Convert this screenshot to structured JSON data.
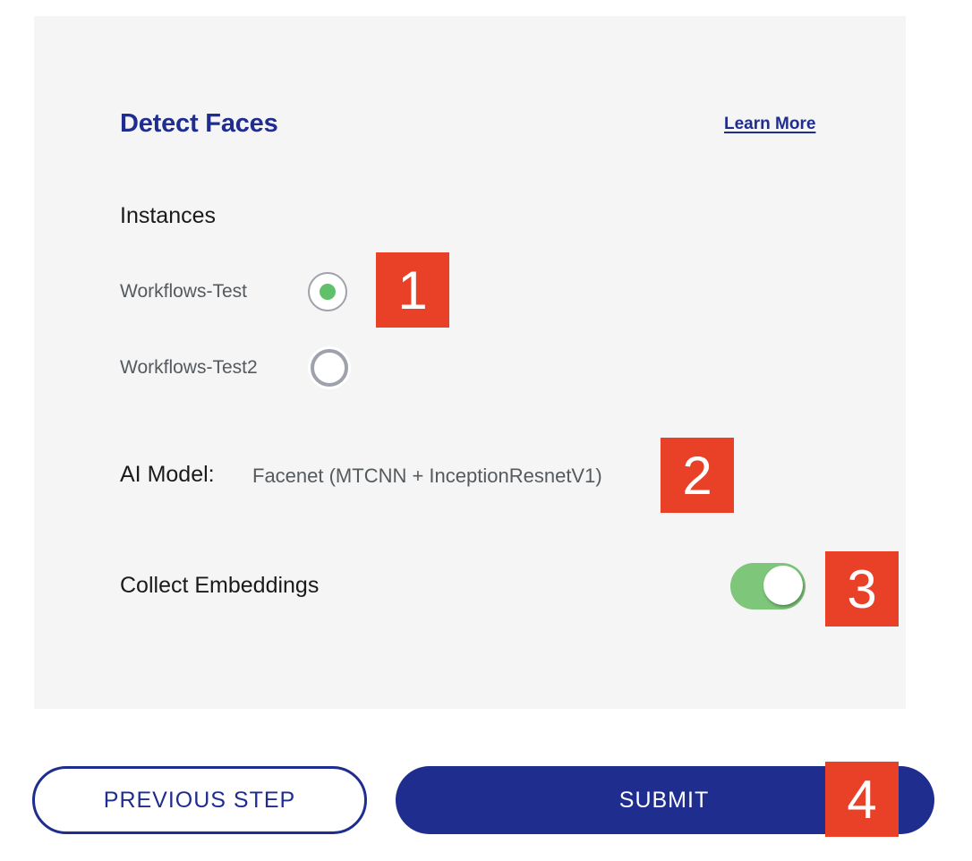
{
  "card": {
    "title": "Detect Faces",
    "learn_more": "Learn More",
    "instances_label": "Instances",
    "instances": [
      {
        "label": "Workflows-Test",
        "selected": true
      },
      {
        "label": "Workflows-Test2",
        "selected": false
      }
    ],
    "ai_model_label": "AI Model:",
    "ai_model_value": "Facenet (MTCNN + InceptionResnetV1)",
    "collect_embeddings_label": "Collect Embeddings",
    "collect_embeddings_on": true
  },
  "actions": {
    "previous_label": "PREVIOUS STEP",
    "submit_label": "SUBMIT"
  },
  "annotations": [
    "1",
    "2",
    "3",
    "4"
  ],
  "colors": {
    "brand": "#1f2d8f",
    "accent_green": "#61c06a",
    "toggle_on": "#7ec67a",
    "badge": "#e84127",
    "panel_bg": "#f5f5f5"
  }
}
